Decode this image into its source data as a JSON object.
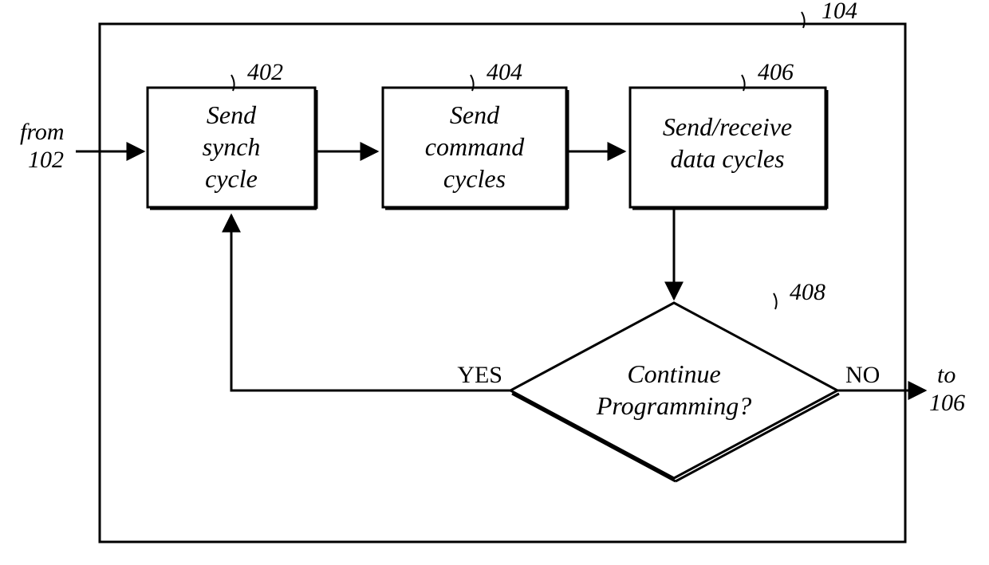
{
  "outer": {
    "ref": "104"
  },
  "entry": {
    "label_line1": "from",
    "label_line2": "102"
  },
  "exit": {
    "label_line1": "to",
    "label_line2": "106"
  },
  "boxes": {
    "b402": {
      "ref": "402",
      "line1": "Send",
      "line2": "synch",
      "line3": "cycle"
    },
    "b404": {
      "ref": "404",
      "line1": "Send",
      "line2": "command",
      "line3": "cycles"
    },
    "b406": {
      "ref": "406",
      "line1": "Send/receive",
      "line2": "data cycles",
      "line3": ""
    }
  },
  "decision": {
    "ref": "408",
    "line1": "Continue",
    "line2": "Programming?",
    "yes": "YES",
    "no": "NO"
  }
}
